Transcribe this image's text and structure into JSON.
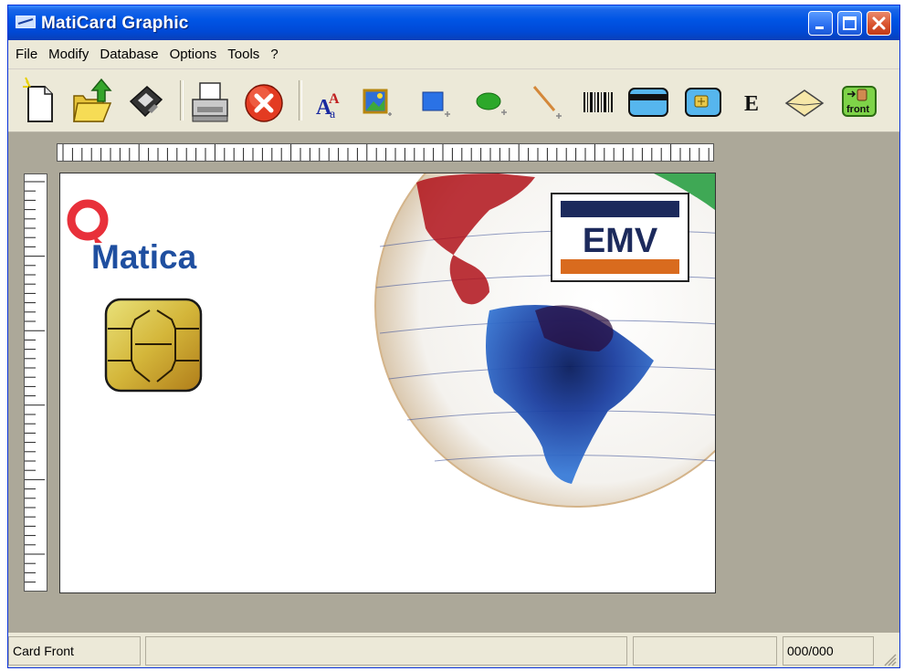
{
  "window": {
    "title": "MatiCard Graphic",
    "controls": {
      "minimize": "minimize",
      "maximize": "maximize",
      "close": "close"
    }
  },
  "menu": {
    "items": [
      "File",
      "Modify",
      "Database",
      "Options",
      "Tools",
      "?"
    ]
  },
  "toolbar": {
    "buttons": [
      "new-icon",
      "open-icon",
      "save-icon",
      "print-icon",
      "delete-icon",
      "text-icon",
      "image-icon",
      "rectangle-icon",
      "ellipse-icon",
      "line-icon",
      "barcode-icon",
      "magnetic-stripe-icon",
      "chip-icon",
      "encode-icon",
      "envelope-icon",
      "front-icon"
    ],
    "encode_label": "E",
    "front_label": "front"
  },
  "card": {
    "logo_text": "Matica",
    "emv_label": "EMV",
    "colors": {
      "matica_red": "#e8303a",
      "matica_blue": "#1f4fa0",
      "emv_navy": "#1c2a5c",
      "emv_orange": "#d96b1e"
    }
  },
  "status": {
    "side": "Card Front",
    "pane2": "",
    "pane3": "",
    "counter": "000/000"
  },
  "theme": {
    "title_blue": "#0055e5",
    "face": "#ece9d8",
    "workspace": "#aca899"
  }
}
